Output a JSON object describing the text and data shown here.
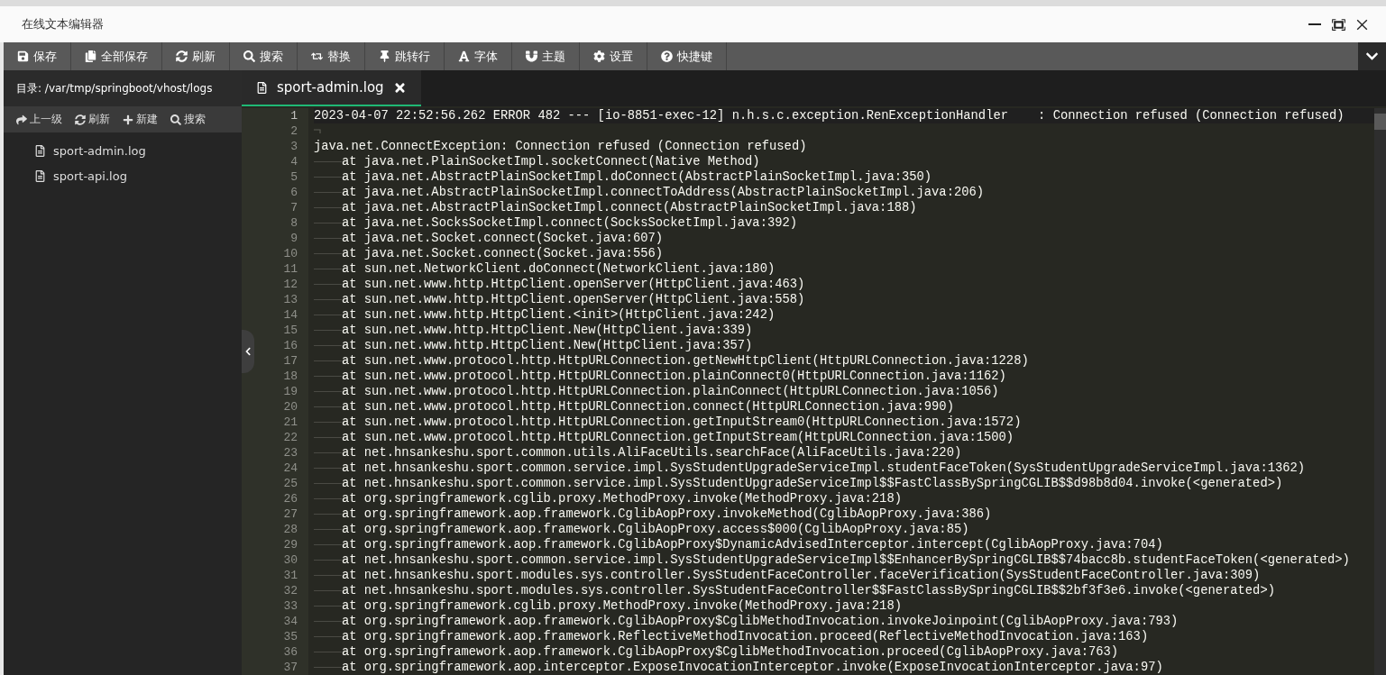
{
  "window": {
    "title": "在线文本编辑器"
  },
  "toolbar": [
    {
      "label": "保存"
    },
    {
      "label": "全部保存"
    },
    {
      "label": "刷新"
    },
    {
      "label": "搜索"
    },
    {
      "label": "替换"
    },
    {
      "label": "跳转行"
    },
    {
      "label": "字体"
    },
    {
      "label": "主题"
    },
    {
      "label": "设置"
    },
    {
      "label": "快捷键"
    }
  ],
  "sidebar": {
    "path": "目录: /var/tmp/springboot/vhost/logs",
    "actions": [
      {
        "label": "上一级"
      },
      {
        "label": "刷新"
      },
      {
        "label": "新建"
      },
      {
        "label": "搜索"
      }
    ],
    "files": [
      {
        "name": "sport-admin.log"
      },
      {
        "name": "sport-api.log"
      }
    ]
  },
  "tabs": [
    {
      "label": "sport-admin.log",
      "selected": true
    }
  ],
  "editor": {
    "lines": [
      {
        "number": "1",
        "indent": false,
        "text": "2023-04-07 22:52:56.262 ERROR 482 --- [io-8851-exec-12] n.h.s.c.exception.RenExceptionHandler    : Connection refused (Connection refused)"
      },
      {
        "number": "2",
        "indent": false
      },
      {
        "number": "3",
        "indent": false,
        "text": "java.net.ConnectException: Connection refused (Connection refused)"
      },
      {
        "number": "4",
        "indent": true,
        "text": "at java.net.PlainSocketImpl.socketConnect(Native Method)"
      },
      {
        "number": "5",
        "indent": true,
        "text": "at java.net.AbstractPlainSocketImpl.doConnect(AbstractPlainSocketImpl.java:350)"
      },
      {
        "number": "6",
        "indent": true,
        "text": "at java.net.AbstractPlainSocketImpl.connectToAddress(AbstractPlainSocketImpl.java:206)"
      },
      {
        "number": "7",
        "indent": true,
        "text": "at java.net.AbstractPlainSocketImpl.connect(AbstractPlainSocketImpl.java:188)"
      },
      {
        "number": "8",
        "indent": true,
        "text": "at java.net.SocksSocketImpl.connect(SocksSocketImpl.java:392)"
      },
      {
        "number": "9",
        "indent": true,
        "text": "at java.net.Socket.connect(Socket.java:607)"
      },
      {
        "number": "10",
        "indent": true,
        "text": "at java.net.Socket.connect(Socket.java:556)"
      },
      {
        "number": "11",
        "indent": true,
        "text": "at sun.net.NetworkClient.doConnect(NetworkClient.java:180)"
      },
      {
        "number": "12",
        "indent": true,
        "text": "at sun.net.www.http.HttpClient.openServer(HttpClient.java:463)"
      },
      {
        "number": "13",
        "indent": true,
        "text": "at sun.net.www.http.HttpClient.openServer(HttpClient.java:558)"
      },
      {
        "number": "14",
        "indent": true,
        "text": "at sun.net.www.http.HttpClient.<init>(HttpClient.java:242)"
      },
      {
        "number": "15",
        "indent": true,
        "text": "at sun.net.www.http.HttpClient.New(HttpClient.java:339)"
      },
      {
        "number": "16",
        "indent": true,
        "text": "at sun.net.www.http.HttpClient.New(HttpClient.java:357)"
      },
      {
        "number": "17",
        "indent": true,
        "text": "at sun.net.www.protocol.http.HttpURLConnection.getNewHttpClient(HttpURLConnection.java:1228)"
      },
      {
        "number": "18",
        "indent": true,
        "text": "at sun.net.www.protocol.http.HttpURLConnection.plainConnect0(HttpURLConnection.java:1162)"
      },
      {
        "number": "19",
        "indent": true,
        "text": "at sun.net.www.protocol.http.HttpURLConnection.plainConnect(HttpURLConnection.java:1056)"
      },
      {
        "number": "20",
        "indent": true,
        "text": "at sun.net.www.protocol.http.HttpURLConnection.connect(HttpURLConnection.java:990)"
      },
      {
        "number": "21",
        "indent": true,
        "text": "at sun.net.www.protocol.http.HttpURLConnection.getInputStream0(HttpURLConnection.java:1572)"
      },
      {
        "number": "22",
        "indent": true,
        "text": "at sun.net.www.protocol.http.HttpURLConnection.getInputStream(HttpURLConnection.java:1500)"
      },
      {
        "number": "23",
        "indent": true,
        "text": "at net.hnsankeshu.sport.common.utils.AliFaceUtils.searchFace(AliFaceUtils.java:220)"
      },
      {
        "number": "24",
        "indent": true,
        "text": "at net.hnsankeshu.sport.common.service.impl.SysStudentUpgradeServiceImpl.studentFaceToken(SysStudentUpgradeServiceImpl.java:1362)"
      },
      {
        "number": "25",
        "indent": true,
        "text": "at net.hnsankeshu.sport.common.service.impl.SysStudentUpgradeServiceImpl$$FastClassBySpringCGLIB$$d98b8d04.invoke(<generated>)"
      },
      {
        "number": "26",
        "indent": true,
        "text": "at org.springframework.cglib.proxy.MethodProxy.invoke(MethodProxy.java:218)"
      },
      {
        "number": "27",
        "indent": true,
        "text": "at org.springframework.aop.framework.CglibAopProxy.invokeMethod(CglibAopProxy.java:386)"
      },
      {
        "number": "28",
        "indent": true,
        "text": "at org.springframework.aop.framework.CglibAopProxy.access$000(CglibAopProxy.java:85)"
      },
      {
        "number": "29",
        "indent": true,
        "text": "at org.springframework.aop.framework.CglibAopProxy$DynamicAdvisedInterceptor.intercept(CglibAopProxy.java:704)"
      },
      {
        "number": "30",
        "indent": true,
        "text": "at net.hnsankeshu.sport.common.service.impl.SysStudentUpgradeServiceImpl$$EnhancerBySpringCGLIB$$74bacc8b.studentFaceToken(<generated>)"
      },
      {
        "number": "31",
        "indent": true,
        "text": "at net.hnsankeshu.sport.modules.sys.controller.SysStudentFaceController.faceVerification(SysStudentFaceController.java:309)"
      },
      {
        "number": "32",
        "indent": true,
        "text": "at net.hnsankeshu.sport.modules.sys.controller.SysStudentFaceController$$FastClassBySpringCGLIB$$2bf3f3e6.invoke(<generated>)"
      },
      {
        "number": "33",
        "indent": true,
        "text": "at org.springframework.cglib.proxy.MethodProxy.invoke(MethodProxy.java:218)"
      },
      {
        "number": "34",
        "indent": true,
        "text": "at org.springframework.aop.framework.CglibAopProxy$CglibMethodInvocation.invokeJoinpoint(CglibAopProxy.java:793)"
      },
      {
        "number": "35",
        "indent": true,
        "text": "at org.springframework.aop.framework.ReflectiveMethodInvocation.proceed(ReflectiveMethodInvocation.java:163)"
      },
      {
        "number": "36",
        "indent": true,
        "text": "at org.springframework.aop.framework.CglibAopProxy$CglibMethodInvocation.proceed(CglibAopProxy.java:763)"
      },
      {
        "number": "37",
        "indent": true,
        "text": "at org.springframework.aop.interceptor.ExposeInvocationInterceptor.invoke(ExposeInvocationInterceptor.java:97)"
      }
    ]
  }
}
